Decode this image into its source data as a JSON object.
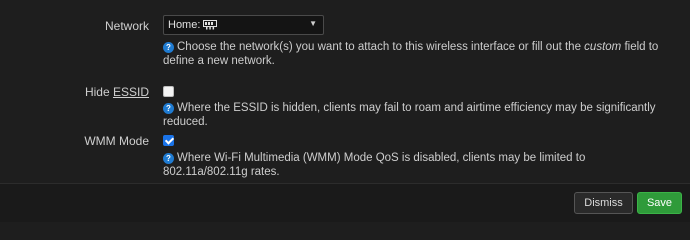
{
  "network": {
    "label": "Network",
    "selected_value": "Home:",
    "help_text_part1": "Choose the network(s) you want to attach to this wireless interface or fill out the ",
    "help_text_emph": "custom",
    "help_text_part2": " field to define a new network."
  },
  "hide_essid": {
    "label_pre": "Hide ",
    "label_underlined": "ESSID",
    "checked": false,
    "help_text": "Where the ESSID is hidden, clients may fail to roam and airtime efficiency may be significantly reduced."
  },
  "wmm_mode": {
    "label": "WMM Mode",
    "checked": true,
    "help_text": "Where Wi-Fi Multimedia (WMM) Mode QoS is disabled, clients may be limited to 802.11a/802.11g rates."
  },
  "footer": {
    "dismiss_label": "Dismiss",
    "save_label": "Save"
  },
  "icons": {
    "help": "?",
    "dropdown_arrow": "▼"
  },
  "colors": {
    "save_button": "#2f9b3a",
    "help_icon": "#1f7bd1",
    "checkbox_checked": "#1a73e8"
  }
}
